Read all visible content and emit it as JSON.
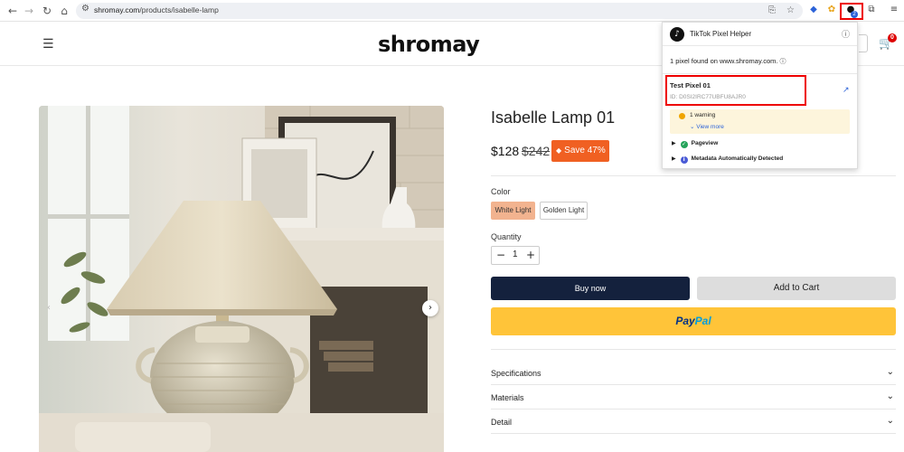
{
  "browser": {
    "back_icon": "arrow-left-icon",
    "forward_icon": "arrow-right-icon",
    "reload_icon": "reload-icon",
    "home_icon": "home-icon",
    "url_domain": "shromay.com",
    "url_path": "/products/isabelle-lamp"
  },
  "header": {
    "logo": "shromay",
    "cart_count": "0"
  },
  "product": {
    "title": "Isabelle Lamp 01",
    "price": "$128",
    "compare_price": "$242",
    "save_label": "Save 47%",
    "color_label": "Color",
    "colors": [
      "White Light",
      "Golden Light"
    ],
    "selected_color": "White Light",
    "quantity_label": "Quantity",
    "quantity": "1",
    "buy_now": "Buy now",
    "add_to_cart": "Add to Cart",
    "paypal_pay": "Pay",
    "paypal_pal": "Pal",
    "accordions": [
      "Specifications",
      "Materials",
      "Detail"
    ]
  },
  "popup": {
    "title": "TikTok Pixel Helper",
    "found_text": "1 pixel found on www.shromay.com.",
    "pixel_name": "Test Pixel 01",
    "pixel_id": "ID:  D0SI2IRC77UBFU8AJR0",
    "warning": "1 warning",
    "view_more": "View more",
    "events": [
      "Pageview",
      "Metadata Automatically Detected"
    ]
  },
  "colors": {
    "buy_now_bg": "#14213d",
    "save_badge": "#f06022",
    "paypal_bg": "#ffc439",
    "selected_swatch": "#f2b38f",
    "highlight_red": "#ee0000"
  }
}
